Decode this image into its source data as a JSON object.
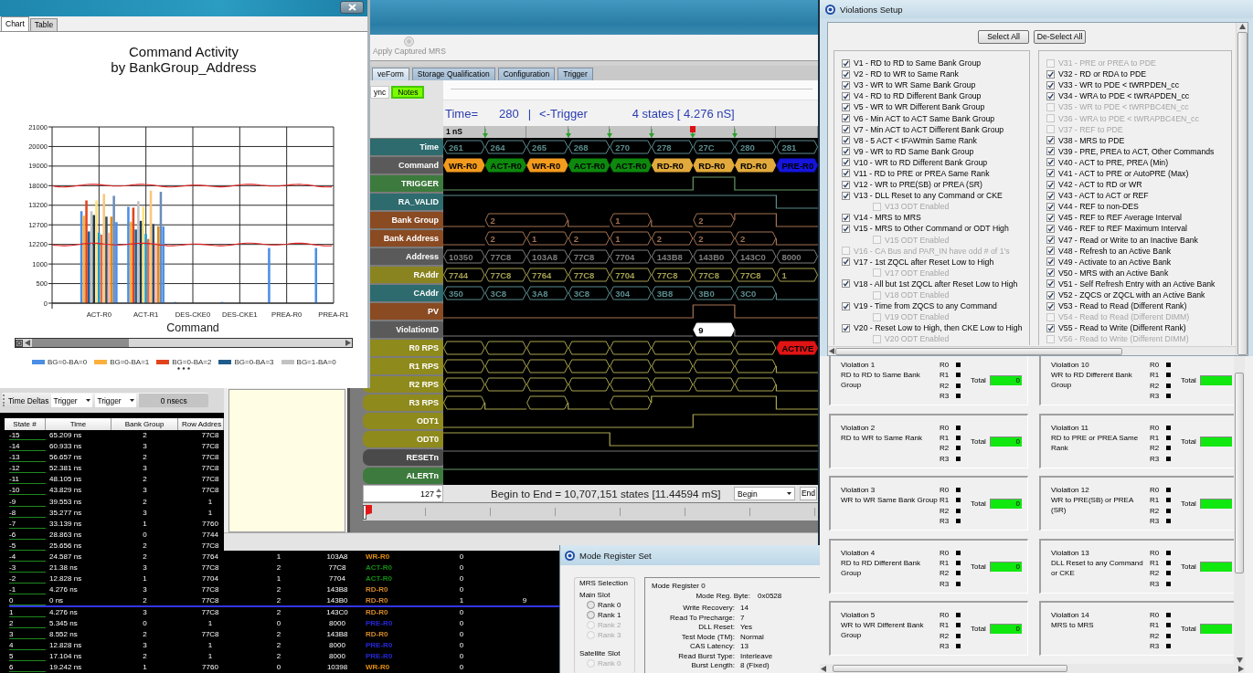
{
  "chart_window": {
    "tabs": [
      {
        "label": "Chart",
        "selected": true
      },
      {
        "label": "Table",
        "selected": false
      }
    ],
    "chart": {
      "title": "Command Activity\nby BankGroup_Address",
      "y_axis_labels": [
        "21000",
        "20000",
        "19000",
        "18000",
        "13200",
        "12700",
        "12200",
        "1000",
        "500",
        "0"
      ],
      "categories": [
        "ACT-R0",
        "ACT-R1",
        "DES-CKE0",
        "DES-CKE1",
        "PREA-R0",
        "PREA-R1"
      ],
      "xlabel": "Command",
      "legend": [
        {
          "label": "BG=0-BA=0",
          "color": "#4a8ee6"
        },
        {
          "label": "BG=0-BA=1",
          "color": "#fbb03b"
        },
        {
          "label": "BG=0-BA=2",
          "color": "#e2431c"
        },
        {
          "label": "BG=0-BA=3",
          "color": "#1f5c8c"
        },
        {
          "label": "BG=1-BA=0",
          "color": "#c2c2c2"
        }
      ]
    }
  },
  "main_window": {
    "toolbar_button": {
      "label": "Apply Captured MRS",
      "disabled": true
    },
    "tabs": [
      {
        "label": "veForm",
        "selected": true
      },
      {
        "label": "Storage Qualification",
        "selected": false
      },
      {
        "label": "Configuration",
        "selected": false
      },
      {
        "label": "Trigger",
        "selected": false
      }
    ],
    "side_buttons": [
      {
        "label": "ync",
        "on": false
      },
      {
        "label": "Notes",
        "on": true
      }
    ],
    "readout": {
      "label": "Time=",
      "value": "280",
      "separator": "|",
      "reference": "<-Trigger",
      "span": "4 states [ 4.276 nS]"
    },
    "ruler": {
      "label": "1 nS",
      "markers": [
        {
          "kind": "none"
        },
        {
          "kind": "marker"
        },
        {
          "kind": "none"
        },
        {
          "kind": "marker"
        },
        {
          "kind": "marker"
        },
        {
          "kind": "marker"
        },
        {
          "kind": "trigger"
        },
        {
          "kind": "marker"
        },
        {
          "kind": "none"
        }
      ]
    },
    "signals": [
      {
        "name": "Time",
        "color": "#2d6b6e",
        "segments": [
          {
            "kind": "value",
            "text": "261"
          },
          {
            "kind": "value",
            "text": "264"
          },
          {
            "kind": "value",
            "text": "265"
          },
          {
            "kind": "value",
            "text": "268"
          },
          {
            "kind": "value",
            "text": "270"
          },
          {
            "kind": "value",
            "text": "278"
          },
          {
            "kind": "value",
            "text": "27C"
          },
          {
            "kind": "value",
            "text": "280"
          },
          {
            "kind": "value",
            "text": "281"
          }
        ]
      },
      {
        "name": "Command",
        "color": "#5a5a5a",
        "segments": [
          {
            "kind": "value",
            "text": "WR-R0",
            "color": "#f39b1d"
          },
          {
            "kind": "value",
            "text": "ACT-R0",
            "color": "#0d890d"
          },
          {
            "kind": "value",
            "text": "WR-R0",
            "color": "#f39b1d"
          },
          {
            "kind": "value",
            "text": "ACT-R0",
            "color": "#0d890d"
          },
          {
            "kind": "value",
            "text": "ACT-R0",
            "color": "#0d890d"
          },
          {
            "kind": "value",
            "text": "RD-R0",
            "color": "#e2aa3c"
          },
          {
            "kind": "value",
            "text": "RD-R0",
            "color": "#e2aa3c"
          },
          {
            "kind": "value",
            "text": "RD-R0",
            "color": "#e2aa3c"
          },
          {
            "kind": "value",
            "text": "PRE-R0",
            "color": "#1515db"
          }
        ]
      },
      {
        "name": "TRIGGER",
        "color": "#3d7a3d",
        "segments": [
          {
            "kind": "low"
          },
          {
            "kind": "low"
          },
          {
            "kind": "low"
          },
          {
            "kind": "low"
          },
          {
            "kind": "low"
          },
          {
            "kind": "low"
          },
          {
            "kind": "high"
          },
          {
            "kind": "low"
          },
          {
            "kind": "low"
          }
        ]
      },
      {
        "name": "RA_VALID",
        "color": "#2d6b6e",
        "segments": [
          {
            "kind": "high"
          },
          {
            "kind": "high"
          },
          {
            "kind": "high"
          },
          {
            "kind": "high"
          },
          {
            "kind": "high"
          },
          {
            "kind": "high"
          },
          {
            "kind": "high"
          },
          {
            "kind": "high"
          },
          {
            "kind": "low"
          }
        ]
      },
      {
        "name": "Bank Group",
        "color": "#8a4a22",
        "segments": [
          {
            "kind": "low"
          },
          {
            "kind": "value",
            "text": "2"
          },
          {
            "kind": "continue"
          },
          {
            "kind": "low"
          },
          {
            "kind": "value",
            "text": "1"
          },
          {
            "kind": "low"
          },
          {
            "kind": "value",
            "text": "2"
          },
          {
            "kind": "high"
          },
          {
            "kind": "low"
          }
        ]
      },
      {
        "name": "Bank Address",
        "color": "#8a4a22",
        "segments": [
          {
            "kind": "low"
          },
          {
            "kind": "value",
            "text": "2"
          },
          {
            "kind": "value",
            "text": "1"
          },
          {
            "kind": "value",
            "text": "2"
          },
          {
            "kind": "value",
            "text": "1"
          },
          {
            "kind": "value",
            "text": "2"
          },
          {
            "kind": "value",
            "text": "2"
          },
          {
            "kind": "value",
            "text": "2"
          },
          {
            "kind": "low"
          }
        ]
      },
      {
        "name": "Address",
        "color": "#5a5a5a",
        "segments": [
          {
            "kind": "value",
            "text": "10350"
          },
          {
            "kind": "value",
            "text": "77C8"
          },
          {
            "kind": "value",
            "text": "103A8"
          },
          {
            "kind": "value",
            "text": "77C8"
          },
          {
            "kind": "value",
            "text": "7704"
          },
          {
            "kind": "value",
            "text": "143B8"
          },
          {
            "kind": "value",
            "text": "143B0"
          },
          {
            "kind": "value",
            "text": "143C0"
          },
          {
            "kind": "value",
            "text": "8000"
          }
        ]
      },
      {
        "name": "RAddr",
        "color": "#8a8420",
        "segments": [
          {
            "kind": "value",
            "text": "7744"
          },
          {
            "kind": "value",
            "text": "77C8"
          },
          {
            "kind": "value",
            "text": "7764"
          },
          {
            "kind": "value",
            "text": "77C8"
          },
          {
            "kind": "value",
            "text": "7704"
          },
          {
            "kind": "value",
            "text": "77C8"
          },
          {
            "kind": "value",
            "text": "77C8"
          },
          {
            "kind": "value",
            "text": "77C8"
          },
          {
            "kind": "value",
            "text": "1"
          }
        ]
      },
      {
        "name": "CAddr",
        "color": "#2d6b6e",
        "segments": [
          {
            "kind": "value",
            "text": "350"
          },
          {
            "kind": "value",
            "text": "3C8"
          },
          {
            "kind": "value",
            "text": "3A8"
          },
          {
            "kind": "value",
            "text": "3C8"
          },
          {
            "kind": "value",
            "text": "304"
          },
          {
            "kind": "value",
            "text": "3B8"
          },
          {
            "kind": "value",
            "text": "3B0"
          },
          {
            "kind": "value",
            "text": "3C0"
          },
          {
            "kind": "low"
          }
        ]
      },
      {
        "name": "PV",
        "color": "#8a4a22",
        "segments": [
          {
            "kind": "low"
          },
          {
            "kind": "low"
          },
          {
            "kind": "low"
          },
          {
            "kind": "low"
          },
          {
            "kind": "low"
          },
          {
            "kind": "low"
          },
          {
            "kind": "high"
          },
          {
            "kind": "low"
          },
          {
            "kind": "low"
          }
        ]
      },
      {
        "name": "ViolationID",
        "color": "#5a5a5a",
        "segments": [
          {
            "kind": "low"
          },
          {
            "kind": "low"
          },
          {
            "kind": "low"
          },
          {
            "kind": "low"
          },
          {
            "kind": "low"
          },
          {
            "kind": "low"
          },
          {
            "kind": "value",
            "text": "9",
            "color": "#ffffff"
          },
          {
            "kind": "low"
          },
          {
            "kind": "low"
          }
        ]
      },
      {
        "name": "R0 RPS",
        "color": "#8f8a1c",
        "segments": [
          {
            "kind": "empty"
          },
          {
            "kind": "empty"
          },
          {
            "kind": "empty"
          },
          {
            "kind": "empty"
          },
          {
            "kind": "empty"
          },
          {
            "kind": "empty"
          },
          {
            "kind": "empty"
          },
          {
            "kind": "empty"
          },
          {
            "kind": "value",
            "text": "ACTIVE",
            "color": "#e01414"
          }
        ]
      },
      {
        "name": "R1 RPS",
        "color": "#8f8a1c",
        "segments": [
          {
            "kind": "empty"
          },
          {
            "kind": "empty"
          },
          {
            "kind": "empty"
          },
          {
            "kind": "empty"
          },
          {
            "kind": "empty"
          },
          {
            "kind": "empty"
          },
          {
            "kind": "empty"
          },
          {
            "kind": "empty"
          },
          {
            "kind": "low"
          }
        ]
      },
      {
        "name": "R2 RPS",
        "color": "#8f8a1c",
        "segments": [
          {
            "kind": "empty"
          },
          {
            "kind": "empty"
          },
          {
            "kind": "empty"
          },
          {
            "kind": "empty"
          },
          {
            "kind": "empty"
          },
          {
            "kind": "empty"
          },
          {
            "kind": "empty"
          },
          {
            "kind": "empty"
          },
          {
            "kind": "low"
          }
        ]
      },
      {
        "name": "R3 RPS",
        "color": "#8f8a1c",
        "segments": [
          {
            "kind": "empty"
          },
          {
            "kind": "low"
          },
          {
            "kind": "empty"
          },
          {
            "kind": "low"
          },
          {
            "kind": "empty"
          },
          {
            "kind": "high"
          },
          {
            "kind": "high"
          },
          {
            "kind": "high"
          },
          {
            "kind": "low"
          }
        ]
      },
      {
        "name": "ODT1",
        "color": "#8f8a1c",
        "segments": [
          {
            "kind": "low"
          },
          {
            "kind": "low"
          },
          {
            "kind": "low"
          },
          {
            "kind": "low"
          },
          {
            "kind": "low"
          },
          {
            "kind": "low"
          },
          {
            "kind": "high"
          },
          {
            "kind": "high"
          },
          {
            "kind": "high"
          }
        ]
      },
      {
        "name": "ODT0",
        "color": "#8f8a1c",
        "segments": [
          {
            "kind": "high"
          },
          {
            "kind": "high"
          },
          {
            "kind": "high"
          },
          {
            "kind": "high"
          },
          {
            "kind": "low"
          },
          {
            "kind": "low"
          },
          {
            "kind": "low"
          },
          {
            "kind": "low"
          },
          {
            "kind": "low"
          }
        ]
      },
      {
        "name": "RESETn",
        "color": "#4a4a4a",
        "segments": [
          {
            "kind": "high"
          },
          {
            "kind": "high"
          },
          {
            "kind": "high"
          },
          {
            "kind": "high"
          },
          {
            "kind": "high"
          },
          {
            "kind": "high"
          },
          {
            "kind": "high"
          },
          {
            "kind": "high"
          },
          {
            "kind": "high"
          }
        ]
      },
      {
        "name": "ALERTn",
        "color": "#3d7a3d",
        "segments": [
          {
            "kind": "high"
          },
          {
            "kind": "high"
          },
          {
            "kind": "high"
          },
          {
            "kind": "high"
          },
          {
            "kind": "high"
          },
          {
            "kind": "high"
          },
          {
            "kind": "high"
          },
          {
            "kind": "high"
          },
          {
            "kind": "high"
          }
        ]
      }
    ],
    "zoom_value": "127",
    "summary": "Begin to End = 10,707,151 states [11.44594 mS]",
    "range_select": "Begin",
    "end_button": "End"
  },
  "table_window": {
    "toolbar": {
      "label": "Time Deltas",
      "from": "Trigger",
      "to": "Trigger",
      "delta": "0 nsecs"
    },
    "columns": [
      "State #",
      "Time",
      "Bank Group",
      "Row Addres"
    ],
    "rows": [
      {
        "selected": false,
        "cells": [
          {
            "text": "-15"
          },
          {
            "text": "65.209 ns"
          },
          {
            "text": "2"
          },
          {
            "text": "77C8"
          }
        ]
      },
      {
        "selected": false,
        "cells": [
          {
            "text": "-14"
          },
          {
            "text": "60.933 ns"
          },
          {
            "text": "3"
          },
          {
            "text": "77C8"
          }
        ]
      },
      {
        "selected": false,
        "cells": [
          {
            "text": "-13"
          },
          {
            "text": "56.657 ns"
          },
          {
            "text": "2"
          },
          {
            "text": "77C8"
          }
        ]
      },
      {
        "selected": false,
        "cells": [
          {
            "text": "-12"
          },
          {
            "text": "52.381 ns"
          },
          {
            "text": "3"
          },
          {
            "text": "77C8"
          }
        ]
      },
      {
        "selected": false,
        "cells": [
          {
            "text": "-11"
          },
          {
            "text": "48.105 ns"
          },
          {
            "text": "2"
          },
          {
            "text": "77C8"
          }
        ]
      },
      {
        "selected": false,
        "cells": [
          {
            "text": "-10"
          },
          {
            "text": "43.829 ns"
          },
          {
            "text": "3"
          },
          {
            "text": "77C8"
          }
        ]
      },
      {
        "selected": false,
        "cells": [
          {
            "text": "-9"
          },
          {
            "text": "39.553 ns"
          },
          {
            "text": "2"
          },
          {
            "text": "1"
          }
        ]
      },
      {
        "selected": false,
        "cells": [
          {
            "text": "-8"
          },
          {
            "text": "35.277 ns"
          },
          {
            "text": "3"
          },
          {
            "text": "1"
          }
        ]
      },
      {
        "selected": false,
        "cells": [
          {
            "text": "-7"
          },
          {
            "text": "33.139 ns"
          },
          {
            "text": "1"
          },
          {
            "text": "7760"
          }
        ]
      },
      {
        "selected": false,
        "cells": [
          {
            "text": "-6"
          },
          {
            "text": "28.863 ns"
          },
          {
            "text": "0"
          },
          {
            "text": "7744"
          }
        ]
      },
      {
        "selected": false,
        "cells": [
          {
            "text": "-5"
          },
          {
            "text": "25.656 ns"
          },
          {
            "text": "2"
          },
          {
            "text": "77C8"
          }
        ]
      },
      {
        "selected": false,
        "cells": [
          {
            "text": "-4"
          },
          {
            "text": "24.587 ns"
          },
          {
            "text": "2"
          },
          {
            "text": "7764"
          },
          {
            "text": "1"
          },
          {
            "text": "103A8"
          },
          {
            "text": "WR-R0",
            "color": "#e08c14"
          },
          {
            "text": "0"
          }
        ]
      },
      {
        "selected": false,
        "cells": [
          {
            "text": "-3"
          },
          {
            "text": "21.38 ns"
          },
          {
            "text": "3"
          },
          {
            "text": "77C8"
          },
          {
            "text": "2"
          },
          {
            "text": "77C8"
          },
          {
            "text": "ACT-R0",
            "color": "#148c14"
          },
          {
            "text": "0"
          }
        ]
      },
      {
        "selected": false,
        "cells": [
          {
            "text": "-2"
          },
          {
            "text": "12.828 ns"
          },
          {
            "text": "1"
          },
          {
            "text": "7704"
          },
          {
            "text": "1"
          },
          {
            "text": "7704"
          },
          {
            "text": "ACT-R0",
            "color": "#148c14"
          },
          {
            "text": "0"
          }
        ]
      },
      {
        "selected": false,
        "cells": [
          {
            "text": "-1"
          },
          {
            "text": "4.276 ns"
          },
          {
            "text": "3"
          },
          {
            "text": "77C8"
          },
          {
            "text": "2"
          },
          {
            "text": "143B8"
          },
          {
            "text": "RD-R0",
            "color": "#d4882a"
          },
          {
            "text": "0"
          }
        ]
      },
      {
        "selected": true,
        "cells": [
          {
            "text": "0"
          },
          {
            "text": "0 ns"
          },
          {
            "text": "2"
          },
          {
            "text": "77C8"
          },
          {
            "text": "2"
          },
          {
            "text": "143B0"
          },
          {
            "text": "RD-R0",
            "color": "#d4882a"
          },
          {
            "text": "1"
          },
          {
            "text": "9"
          }
        ]
      },
      {
        "selected": false,
        "cells": [
          {
            "text": "1"
          },
          {
            "text": "4.276 ns"
          },
          {
            "text": "3"
          },
          {
            "text": "77C8"
          },
          {
            "text": "2"
          },
          {
            "text": "143C0"
          },
          {
            "text": "RD-R0",
            "color": "#d4882a"
          },
          {
            "text": "0"
          }
        ]
      },
      {
        "selected": false,
        "cells": [
          {
            "text": "2"
          },
          {
            "text": "5.345 ns"
          },
          {
            "text": "0"
          },
          {
            "text": "1"
          },
          {
            "text": "0"
          },
          {
            "text": "8000"
          },
          {
            "text": "PRE-R0",
            "color": "#2626d6"
          },
          {
            "text": "0"
          }
        ]
      },
      {
        "selected": false,
        "cells": [
          {
            "text": "3"
          },
          {
            "text": "8.552 ns"
          },
          {
            "text": "2"
          },
          {
            "text": "77C8"
          },
          {
            "text": "2"
          },
          {
            "text": "143B8"
          },
          {
            "text": "RD-R0",
            "color": "#d4882a"
          },
          {
            "text": "0"
          }
        ]
      },
      {
        "selected": false,
        "cells": [
          {
            "text": "4"
          },
          {
            "text": "12.828 ns"
          },
          {
            "text": "3"
          },
          {
            "text": "1"
          },
          {
            "text": "2"
          },
          {
            "text": "8000"
          },
          {
            "text": "PRE-R0",
            "color": "#2626d6"
          },
          {
            "text": "0"
          }
        ]
      },
      {
        "selected": false,
        "cells": [
          {
            "text": "5"
          },
          {
            "text": "17.104 ns"
          },
          {
            "text": "2"
          },
          {
            "text": "1"
          },
          {
            "text": "2"
          },
          {
            "text": "8000"
          },
          {
            "text": "PRE-R0",
            "color": "#2626d6"
          },
          {
            "text": "0"
          }
        ]
      },
      {
        "selected": false,
        "cells": [
          {
            "text": "6"
          },
          {
            "text": "19.242 ns"
          },
          {
            "text": "1"
          },
          {
            "text": "7760"
          },
          {
            "text": "0"
          },
          {
            "text": "10398"
          },
          {
            "text": "WR-R0",
            "color": "#e08c14"
          },
          {
            "text": "0"
          }
        ]
      }
    ]
  },
  "violations_setup": {
    "title": "Violations Setup",
    "buttons": [
      {
        "label": "Select All"
      },
      {
        "label": "De-Select All"
      }
    ],
    "groups": [
      {
        "items": [
          {
            "label": "V1 - RD to RD to Same Bank Group",
            "checked": true,
            "disabled": false
          },
          {
            "label": "V2 - RD to WR to Same Rank",
            "checked": true,
            "disabled": false
          },
          {
            "label": "V3 - WR to WR Same Bank Group",
            "checked": true,
            "disabled": false
          },
          {
            "label": "V4 - RD to RD Different Bank Group",
            "checked": true,
            "disabled": false
          },
          {
            "label": "V5 - WR to WR Different Bank Group",
            "checked": true,
            "disabled": false
          },
          {
            "label": "V6 - Min ACT to ACT Same Bank Group",
            "checked": true,
            "disabled": false
          },
          {
            "label": "V7 - Min ACT to ACT Different Bank Group",
            "checked": true,
            "disabled": false
          },
          {
            "label": "V8 - 5 ACT < tFAWmin Same Rank",
            "checked": true,
            "disabled": false
          },
          {
            "label": "V9 - WR to RD Same Bank Group",
            "checked": true,
            "disabled": false
          },
          {
            "label": "V10 - WR to RD Different Bank Group",
            "checked": true,
            "disabled": false
          },
          {
            "label": "V11 - RD to PRE or PREA Same Rank",
            "checked": true,
            "disabled": false
          },
          {
            "label": "V12 - WR to PRE(SB) or PREA (SR)",
            "checked": true,
            "disabled": false
          },
          {
            "label": "V13 - DLL Reset to any Command or CKE",
            "checked": true,
            "disabled": false,
            "children": [
              {
                "label": "V13 ODT Enabled",
                "checked": false,
                "disabled": true
              }
            ]
          },
          {
            "label": "V14 - MRS to MRS",
            "checked": true,
            "disabled": false
          },
          {
            "label": "V15 - MRS to Other Command or ODT High",
            "checked": true,
            "disabled": false,
            "children": [
              {
                "label": "V15 ODT Enabled",
                "checked": false,
                "disabled": true
              }
            ]
          },
          {
            "label": "V16 - CA Bus and PAR_IN have odd # of 1's",
            "checked": false,
            "disabled": true
          },
          {
            "label": "V17 - 1st ZQCL after Reset Low to High",
            "checked": true,
            "disabled": false,
            "children": [
              {
                "label": "V17 ODT Enabled",
                "checked": false,
                "disabled": true
              }
            ]
          },
          {
            "label": "V18 - All but 1st ZQCL after Reset Low to High",
            "checked": true,
            "disabled": false,
            "children": [
              {
                "label": "V18 ODT Enabled",
                "checked": false,
                "disabled": true
              }
            ]
          },
          {
            "label": "V19 - Time from ZQCS to any Command",
            "checked": true,
            "disabled": false,
            "children": [
              {
                "label": "V19 ODT Enabled",
                "checked": false,
                "disabled": true
              }
            ]
          },
          {
            "label": "V20 - Reset Low to High, then CKE Low to High",
            "checked": true,
            "disabled": false,
            "children": [
              {
                "label": "V20 ODT Enabled",
                "checked": false,
                "disabled": true
              }
            ]
          }
        ]
      },
      {
        "items": [
          {
            "label": "V31 - PRE or PREA to PDE",
            "checked": false,
            "disabled": true
          },
          {
            "label": "V32 - RD or RDA to PDE",
            "checked": true,
            "disabled": false
          },
          {
            "label": "V33 - WR to PDE < tWRPDEN_cc",
            "checked": true,
            "disabled": false
          },
          {
            "label": "V34 - WRA to PDE < tWRAPDEN_cc",
            "checked": true,
            "disabled": false
          },
          {
            "label": "V35 - WR to PDE < tWRPBC4EN_cc",
            "checked": false,
            "disabled": true
          },
          {
            "label": "V36 - WRA to PDE < tWRAPBC4EN_cc",
            "checked": false,
            "disabled": true
          },
          {
            "label": "V37 - REF to PDE",
            "checked": false,
            "disabled": true
          },
          {
            "label": "V38 - MRS to PDE",
            "checked": true,
            "disabled": false
          },
          {
            "label": "V39 - PRE, PREA to ACT, Other Commands",
            "checked": true,
            "disabled": false
          },
          {
            "label": "V40 - ACT to PRE, PREA (Min)",
            "checked": true,
            "disabled": false
          },
          {
            "label": "V41 - ACT to PRE or AutoPRE (Max)",
            "checked": true,
            "disabled": false
          },
          {
            "label": "V42 - ACT to RD or WR",
            "checked": true,
            "disabled": false
          },
          {
            "label": "V43 - ACT to ACT or REF",
            "checked": true,
            "disabled": false
          },
          {
            "label": "V44 - REF to non-DES",
            "checked": true,
            "disabled": false
          },
          {
            "label": "V45 - REF to REF Average Interval",
            "checked": true,
            "disabled": false
          },
          {
            "label": "V46 - REF to REF Maximum Interval",
            "checked": true,
            "disabled": false
          },
          {
            "label": "V47 - Read or Write to an Inactive Bank",
            "checked": true,
            "disabled": false
          },
          {
            "label": "V48 - Refresh to an Active Bank",
            "checked": true,
            "disabled": false
          },
          {
            "label": "V49 - Activate to an Active Bank",
            "checked": true,
            "disabled": false
          },
          {
            "label": "V50 - MRS with an Active Bank",
            "checked": true,
            "disabled": false
          },
          {
            "label": "V51 - Self Refresh Entry with an Active Bank",
            "checked": true,
            "disabled": false
          },
          {
            "label": "V52 - ZQCS or ZQCL with an Active Bank",
            "checked": true,
            "disabled": false
          },
          {
            "label": "V53 - Read to Read (Different Rank)",
            "checked": true,
            "disabled": false
          },
          {
            "label": "V54 - Read to Read (Different DIMM)",
            "checked": false,
            "disabled": true
          },
          {
            "label": "V55 - Read to Write (Different Rank)",
            "checked": true,
            "disabled": false
          },
          {
            "label": "V56 - Read to Write (Different DIMM)",
            "checked": false,
            "disabled": true
          }
        ]
      }
    ]
  },
  "violation_counts": {
    "cards": [
      {
        "title": "Violation 1",
        "description": "RD to RD to Same Bank Group",
        "ranks": [
          "R0",
          "R1",
          "R2",
          "R3"
        ],
        "total_label": "Total",
        "total": "0"
      },
      {
        "title": "Violation 10",
        "description": "WR to RD Different Bank Group",
        "ranks": [
          "R0",
          "R1",
          "R2",
          "R3"
        ],
        "total_label": "Total"
      },
      {
        "title": "Violation 2",
        "description": "RD to WR to Same Rank",
        "ranks": [
          "R0",
          "R1",
          "R2",
          "R3"
        ],
        "total_label": "Total",
        "total": "0"
      },
      {
        "title": "Violation 11",
        "description": "RD to PRE or PREA Same Rank",
        "ranks": [
          "R0",
          "R1",
          "R2",
          "R3"
        ],
        "total_label": "Total"
      },
      {
        "title": "Violation 3",
        "description": "WR to WR Same Bank Group",
        "ranks": [
          "R0",
          "R1",
          "R2",
          "R3"
        ],
        "total_label": "Total",
        "total": "0"
      },
      {
        "title": "Violation 12",
        "description": "WR to PRE(SB) or PREA (SR)",
        "ranks": [
          "R0",
          "R1",
          "R2",
          "R3"
        ],
        "total_label": "Total"
      },
      {
        "title": "Violation 4",
        "description": "RD to RD Different Bank Group",
        "ranks": [
          "R0",
          "R1",
          "R2",
          "R3"
        ],
        "total_label": "Total",
        "total": "0"
      },
      {
        "title": "Violation 13",
        "description": "DLL Reset to any Command or CKE",
        "ranks": [
          "R0",
          "R1",
          "R2",
          "R3"
        ],
        "total_label": "Total"
      },
      {
        "title": "Violation 5",
        "description": "WR to WR Different Bank Group",
        "ranks": [
          "R0",
          "R1",
          "R2",
          "R3"
        ],
        "total_label": "Total",
        "total": "0"
      },
      {
        "title": "Violation 14",
        "description": "MRS to MRS",
        "ranks": [
          "R0",
          "R1",
          "R2",
          "R3"
        ],
        "total_label": "Total"
      }
    ]
  },
  "mode_register_window": {
    "title": "Mode Register Set",
    "selection": {
      "title": "MRS Selection",
      "slots": [
        {
          "label": "Main Slot",
          "ranks": [
            {
              "label": "Rank 0",
              "selected": false,
              "disabled": false
            },
            {
              "label": "Rank 1",
              "selected": false,
              "disabled": false
            },
            {
              "label": "Rank 2",
              "selected": false,
              "disabled": true
            },
            {
              "label": "Rank 3",
              "selected": false,
              "disabled": true
            }
          ]
        },
        {
          "label": "Satellite Slot",
          "ranks": [
            {
              "label": "Rank 0",
              "selected": false,
              "disabled": true
            }
          ]
        }
      ]
    },
    "register": {
      "title": "Mode Register 0",
      "byte_label": "Mode Reg. Byte:",
      "byte_value": "0x0528",
      "fields": [
        {
          "label": "Write Recovery:",
          "value": "14"
        },
        {
          "label": "Read To Precharge:",
          "value": "7"
        },
        {
          "label": "DLL Reset:",
          "value": "Yes"
        },
        {
          "label": "Test Mode (TM):",
          "value": "Normal"
        },
        {
          "label": "CAS Latency:",
          "value": "13"
        },
        {
          "label": "Read Burst Type:",
          "value": "Interleave"
        },
        {
          "label": "Burst Length:",
          "value": "8 (Fixed)"
        }
      ]
    }
  }
}
